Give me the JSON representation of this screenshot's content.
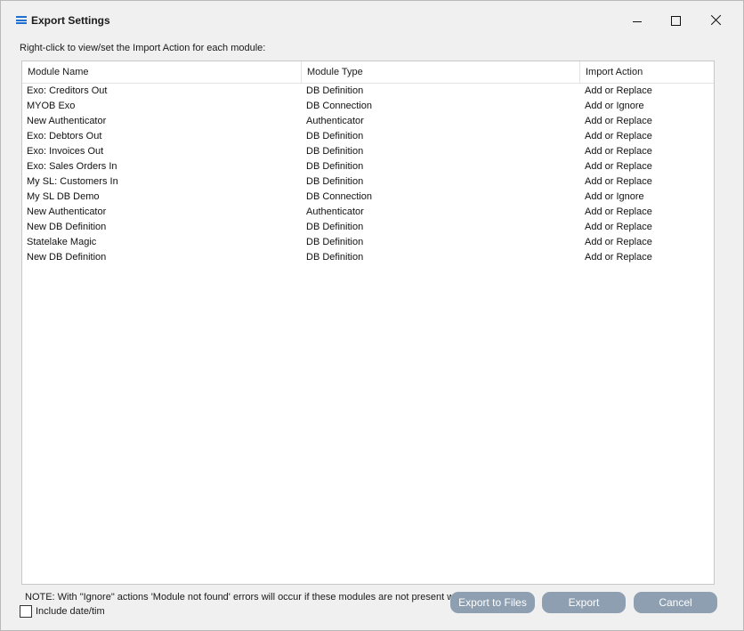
{
  "window": {
    "title": "Export Settings"
  },
  "instruction": "Right-click to view/set the Import Action for each module:",
  "table": {
    "columns": [
      "Module Name",
      "Module Type",
      "Import Action"
    ],
    "rows": [
      {
        "name": "Exo: Creditors Out",
        "type": "DB Definition",
        "action": "Add or Replace"
      },
      {
        "name": "MYOB Exo",
        "type": "DB Connection",
        "action": "Add or Ignore"
      },
      {
        "name": "New Authenticator",
        "type": "Authenticator",
        "action": "Add or Replace"
      },
      {
        "name": "Exo: Debtors Out",
        "type": "DB Definition",
        "action": "Add or Replace"
      },
      {
        "name": "Exo: Invoices Out",
        "type": "DB Definition",
        "action": "Add or Replace"
      },
      {
        "name": "Exo: Sales Orders In",
        "type": "DB Definition",
        "action": "Add or Replace"
      },
      {
        "name": "My SL: Customers In",
        "type": "DB Definition",
        "action": "Add or Replace"
      },
      {
        "name": "My SL DB Demo",
        "type": "DB Connection",
        "action": "Add or Ignore"
      },
      {
        "name": "New Authenticator",
        "type": "Authenticator",
        "action": "Add or Replace"
      },
      {
        "name": "New DB Definition",
        "type": "DB Definition",
        "action": "Add or Replace"
      },
      {
        "name": "Statelake Magic",
        "type": "DB Definition",
        "action": "Add or Replace"
      },
      {
        "name": "New DB Definition",
        "type": "DB Definition",
        "action": "Add or Replace"
      }
    ]
  },
  "note": "NOTE: With \"Ignore\" actions 'Module not found' errors will occur if these modules are not present wh",
  "checkbox": {
    "label": "Include date/tim",
    "checked": false
  },
  "buttons": {
    "export_to_files": "Export to Files",
    "export": "Export",
    "cancel": "Cancel"
  },
  "colors": {
    "accent": "#1f6fd1",
    "button": "#8d9fb1"
  }
}
